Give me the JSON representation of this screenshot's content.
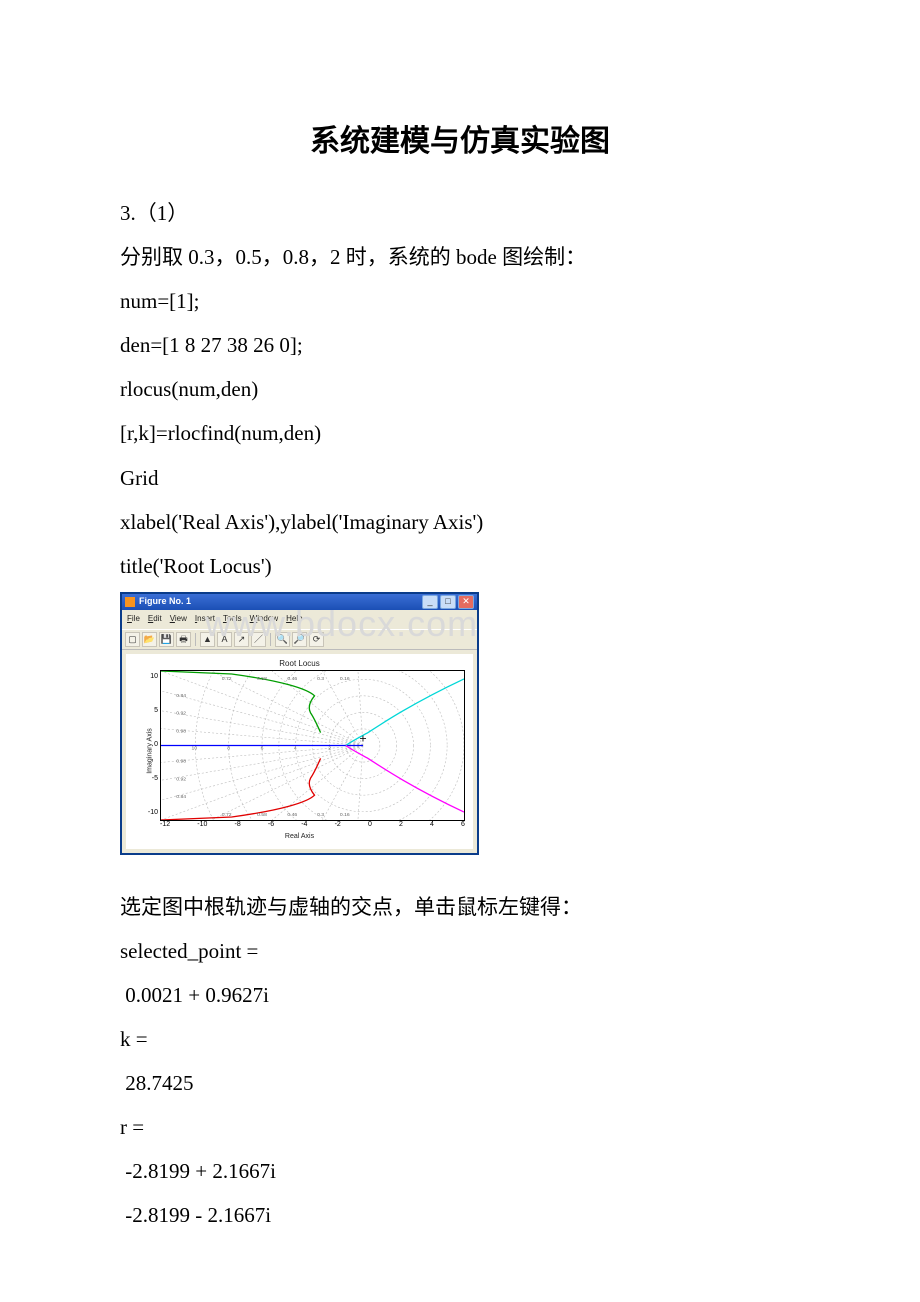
{
  "title": "系统建模与仿真实验图",
  "body_lines": [
    "3.（1）",
    "分别取 0.3，0.5，0.8，2 时，系统的 bode 图绘制：",
    "num=[1];",
    "den=[1 8 27 38 26 0];",
    "rlocus(num,den)",
    "[r,k]=rlocfind(num,den)",
    "Grid",
    "xlabel('Real Axis'),ylabel('Imaginary Axis')",
    "title('Root Locus')"
  ],
  "after_lines": [
    "选定图中根轨迹与虚轴的交点，单击鼠标左键得：",
    "selected_point =",
    " 0.0021 + 0.9627i",
    "k =",
    " 28.7425",
    "r =",
    " -2.8199 + 2.1667i",
    " -2.8199 - 2.1667i"
  ],
  "watermark": "www.bdocx.com",
  "figure": {
    "window_title": "Figure No. 1",
    "menus": [
      "File",
      "Edit",
      "View",
      "Insert",
      "Tools",
      "Window",
      "Help"
    ],
    "plot_title": "Root Locus",
    "xlabel": "Real Axis",
    "ylabel": "Imaginary Axis",
    "xticks": [
      "-12",
      "-10",
      "-8",
      "-6",
      "-4",
      "-2",
      "0",
      "2",
      "4",
      "6"
    ],
    "yticks": [
      "10",
      "5",
      "0",
      "-5",
      "-10"
    ],
    "damping_labels": [
      "0.72",
      "0.58",
      "0.46",
      "0.3",
      "0.16"
    ],
    "freq_labels": [
      "10",
      "8",
      "6",
      "4",
      "2"
    ],
    "inner_y_labels": [
      "0.84",
      "0.92",
      "0.98",
      "0.98",
      "0.92",
      "0.84"
    ]
  },
  "chart_data": {
    "type": "root_locus",
    "title": "Root Locus",
    "xlabel": "Real Axis",
    "ylabel": "Imaginary Axis",
    "xlim": [
      -12,
      6
    ],
    "ylim": [
      -10,
      10
    ],
    "open_loop_poles_x": [
      0,
      -1.0,
      -2.0,
      -2.5,
      -2.5
    ],
    "damping_ratio_grid": [
      0.16,
      0.3,
      0.46,
      0.58,
      0.72,
      0.84,
      0.92,
      0.98
    ],
    "natural_frequency_grid": [
      2,
      4,
      6,
      8,
      10
    ],
    "branches": [
      {
        "name": "branch1",
        "color": "#00aa00",
        "points_x": [
          -2.5,
          -2.7,
          -3.0,
          -3.4,
          -3.8,
          -5.0,
          -9.0,
          -12.0
        ],
        "points_y": [
          1.66,
          2.0,
          2.4,
          3.2,
          4.8,
          7.5,
          9.5,
          10.0
        ]
      },
      {
        "name": "branch2",
        "color": "#ff0000",
        "points_x": [
          -2.5,
          -2.7,
          -3.0,
          -3.4,
          -3.8,
          -5.0,
          -9.0,
          -12.0
        ],
        "points_y": [
          -1.66,
          -2.0,
          -2.4,
          -3.2,
          -4.8,
          -7.5,
          -9.5,
          -10.0
        ]
      },
      {
        "name": "branch3",
        "color": "#00e6e6",
        "points_x": [
          -1.0,
          -0.5,
          0.0,
          0.5,
          1.5,
          3.0,
          5.0,
          6.0
        ],
        "points_y": [
          0.0,
          0.6,
          1.0,
          1.5,
          2.8,
          5.0,
          7.5,
          8.5
        ]
      },
      {
        "name": "branch4",
        "color": "#ff00ff",
        "points_x": [
          -1.0,
          -0.5,
          0.0,
          0.5,
          1.5,
          3.0,
          5.0,
          6.0
        ],
        "points_y": [
          0.0,
          -0.6,
          -1.0,
          -1.5,
          -2.8,
          -5.0,
          -7.5,
          -8.5
        ]
      },
      {
        "name": "branch5",
        "color": "#0000ff",
        "points_x": [
          0.0,
          -2.0,
          -4.0,
          -6.0,
          -8.0,
          -10.0,
          -12.0
        ],
        "points_y": [
          0,
          0,
          0,
          0,
          0,
          0,
          0
        ]
      }
    ],
    "selected_point": {
      "re": 0.0021,
      "im": 0.9627
    },
    "gain_at_selection": 28.7425,
    "closed_loop_roots_at_selection": [
      {
        "re": -2.8199,
        "im": 2.1667
      },
      {
        "re": -2.8199,
        "im": -2.1667
      }
    ]
  }
}
